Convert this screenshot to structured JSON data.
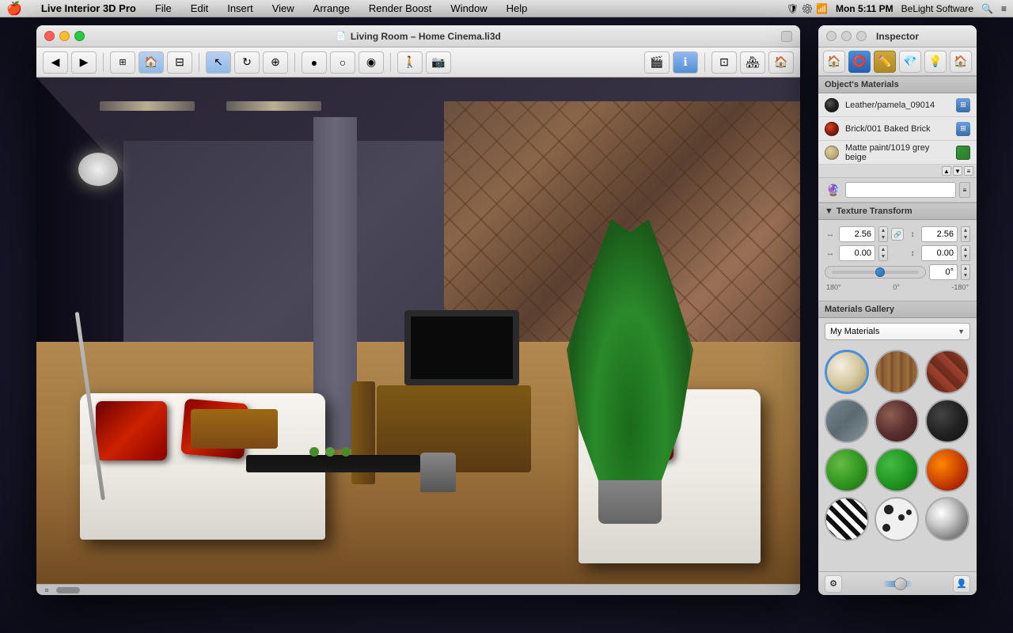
{
  "menubar": {
    "apple": "🍎",
    "app_name": "Live Interior 3D Pro",
    "menus": [
      "File",
      "Edit",
      "Insert",
      "View",
      "Arrange",
      "Render Boost",
      "Window",
      "Help"
    ],
    "time": "Mon 5:11 PM",
    "company": "BeLight Software"
  },
  "main_window": {
    "title": "Living Room – Home Cinema.li3d",
    "title_icon": "📄"
  },
  "inspector": {
    "title": "Inspector",
    "tabs": [
      "🏠",
      "⭕",
      "✏️",
      "💎",
      "💡",
      "🏠"
    ],
    "section_materials": "Object's Materials",
    "materials": [
      {
        "name": "Leather/pamela_09014",
        "color": "#333333",
        "type": "dark"
      },
      {
        "name": "Brick/001 Baked Brick",
        "color": "#cc3300",
        "type": "red"
      },
      {
        "name": "Matte paint/1019 grey beige",
        "color": "#c8b878",
        "type": "beige"
      }
    ],
    "section_texture": "Texture Transform",
    "texture": {
      "width": "2.56",
      "height": "2.56",
      "offset_x": "0.00",
      "offset_y": "0.00",
      "angle": "0°",
      "label_180": "180°",
      "label_0": "0°",
      "label_neg180": "-180°"
    },
    "section_gallery": "Materials Gallery",
    "gallery_dropdown": "My Materials",
    "gallery_materials": [
      {
        "type": "cream",
        "selected": true
      },
      {
        "type": "wood",
        "selected": false
      },
      {
        "type": "brick",
        "selected": false
      },
      {
        "type": "tile",
        "selected": false
      },
      {
        "type": "brown",
        "selected": false
      },
      {
        "type": "dark",
        "selected": false
      },
      {
        "type": "green1",
        "selected": false
      },
      {
        "type": "green2",
        "selected": false
      },
      {
        "type": "fire",
        "selected": false
      },
      {
        "type": "zebra",
        "selected": false
      },
      {
        "type": "spots",
        "selected": false
      },
      {
        "type": "silver",
        "selected": false
      }
    ]
  }
}
